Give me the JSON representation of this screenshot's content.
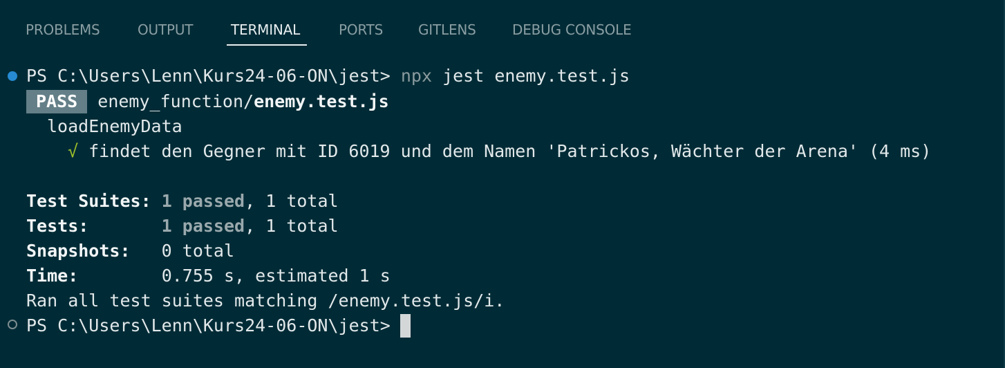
{
  "tabs": [
    {
      "label": "PROBLEMS"
    },
    {
      "label": "OUTPUT"
    },
    {
      "label": "TERMINAL",
      "active": true
    },
    {
      "label": "PORTS"
    },
    {
      "label": "GITLENS"
    },
    {
      "label": "DEBUG CONSOLE"
    }
  ],
  "terminal": {
    "prompt": "PS C:\\Users\\Lenn\\Kurs24-06-ON\\jest>",
    "command_npx": "npx",
    "command_rest": "jest enemy.test.js",
    "pass_badge": "PASS",
    "suite_dir": "enemy_function/",
    "suite_file": "enemy.test.js",
    "describe": "loadEnemyData",
    "check_mark": "√",
    "test_name": "findet den Gegner mit ID 6019 und dem Namen 'Patrickos, Wächter der Arena' (4 ms)",
    "summary": {
      "suites_label": "Test Suites:",
      "suites_passed": "1 passed",
      "suites_total": ", 1 total",
      "tests_label": "Tests:",
      "tests_passed": "1 passed",
      "tests_total": ", 1 total",
      "snapshots_label": "Snapshots:",
      "snapshots_value": "0 total",
      "time_label": "Time:",
      "time_value": "0.755 s, estimated 1 s"
    },
    "ran_all": "Ran all test suites matching /enemy.test.js/i.",
    "accent_color": "#268bd2",
    "pass_color": "#647f88",
    "check_color": "#9fc02a"
  }
}
